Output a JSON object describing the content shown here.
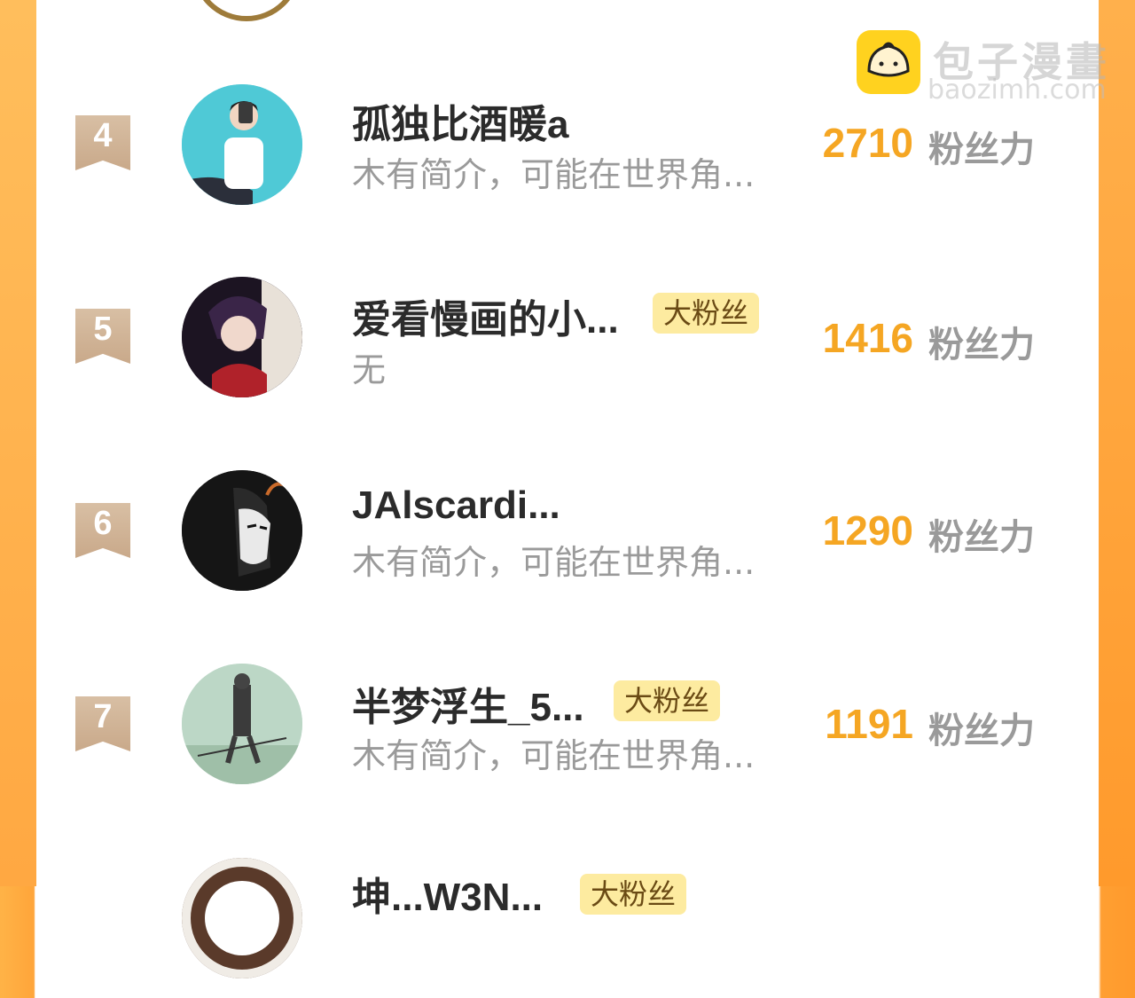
{
  "watermark": {
    "title": "包子漫畫",
    "subtitle": "baozimh.com"
  },
  "rows": [
    {
      "rank": "4",
      "name": "孤独比酒暖a",
      "badge": "",
      "bio": "木有简介，可能在世界角...",
      "score": "2710",
      "score_label": "粉丝力"
    },
    {
      "rank": "5",
      "name": "爱看慢画的小...",
      "badge": "大粉丝",
      "bio": "无",
      "score": "1416",
      "score_label": "粉丝力"
    },
    {
      "rank": "6",
      "name": "JAlscardi...",
      "badge": "",
      "bio": "木有简介，可能在世界角...",
      "score": "1290",
      "score_label": "粉丝力"
    },
    {
      "rank": "7",
      "name": "半梦浮生_5...",
      "badge": "大粉丝",
      "bio": "木有简介，可能在世界角...",
      "score": "1191",
      "score_label": "粉丝力"
    },
    {
      "rank": "",
      "name": "坤...W3N...",
      "badge": "大粉丝",
      "bio": "",
      "score": "",
      "score_label": ""
    }
  ],
  "colors": {
    "accent": "#f5a623",
    "badge_bg": "#fdeba0",
    "rank_flag": "#c9a98a",
    "side_bars": "#ffa53a"
  }
}
